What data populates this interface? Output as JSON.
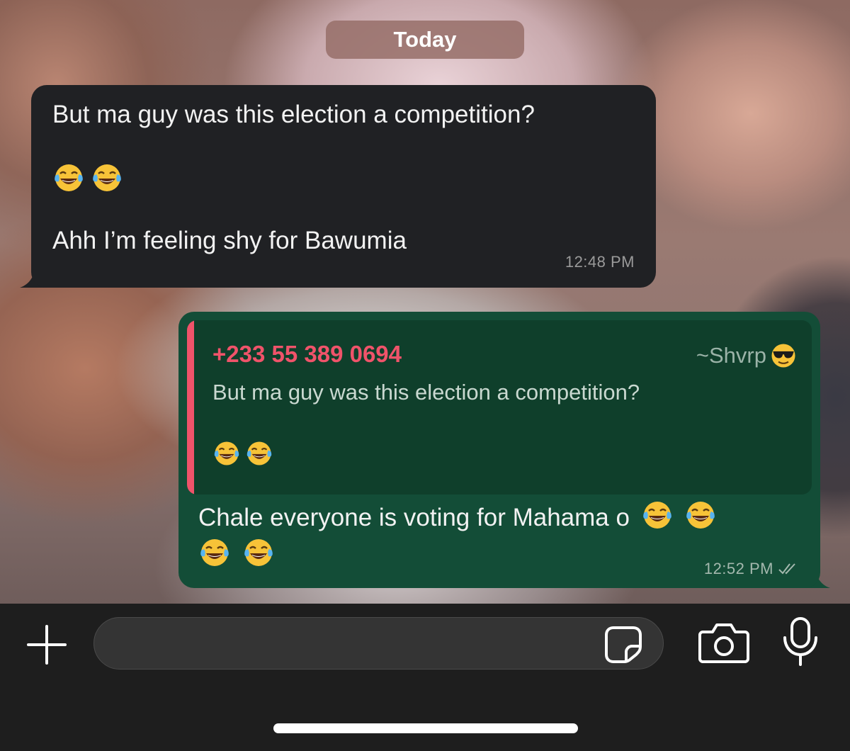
{
  "date_separator": "Today",
  "incoming": {
    "line1": "But ma guy was this election a competition?",
    "emojis": [
      "😂",
      "😂"
    ],
    "line2": "Ahh I’m feeling shy for Bawumia",
    "time": "12:48 PM"
  },
  "outgoing": {
    "quote": {
      "sender": "+233 55 389 0694",
      "alias": "~Shvrp",
      "alias_emoji": "😎",
      "text": "But ma guy was this election a competition?",
      "emojis": [
        "😂",
        "😂"
      ]
    },
    "text": "Chale everyone is voting for Mahama o",
    "emojis": [
      "😂",
      "😂",
      "😂",
      "😂"
    ],
    "time": "12:52 PM",
    "status": "read-double-check"
  },
  "composer": {
    "placeholder": "",
    "icons": [
      "plus-icon",
      "sticker-icon",
      "camera-icon",
      "microphone-icon"
    ]
  },
  "colors": {
    "incoming_bubble": "#202124",
    "outgoing_bubble": "#134d37",
    "quote_accent": "#f0536a"
  }
}
